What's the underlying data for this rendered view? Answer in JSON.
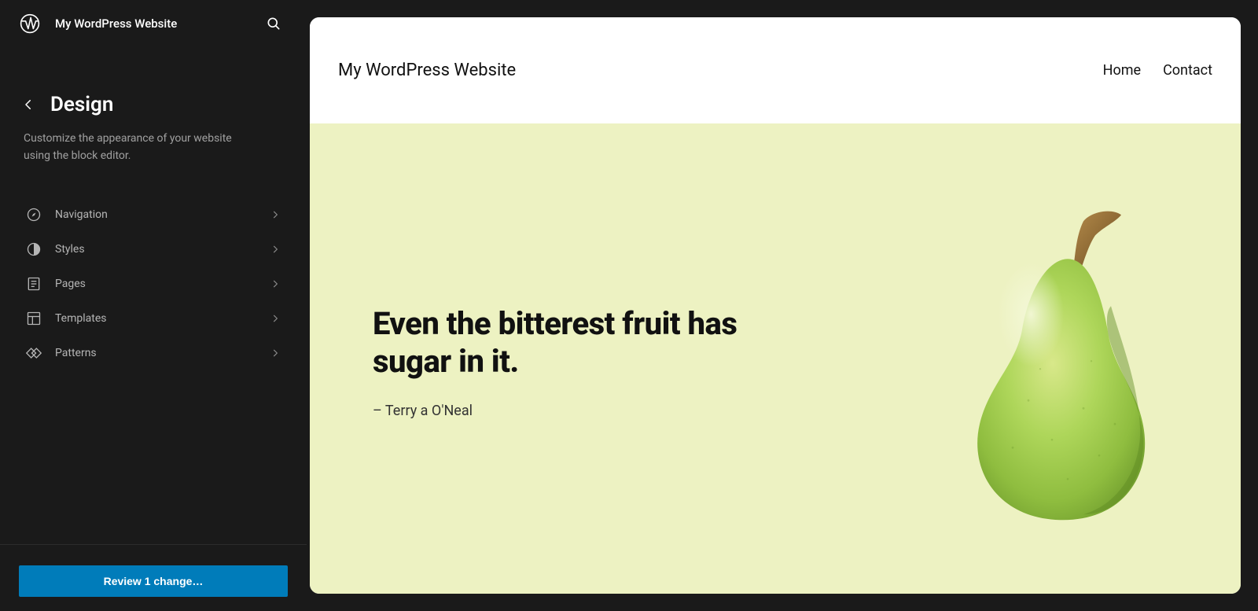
{
  "header": {
    "site_name": "My WordPress Website"
  },
  "panel": {
    "title": "Design",
    "description": "Customize the appearance of your website using the block editor."
  },
  "nav": {
    "items": [
      {
        "label": "Navigation",
        "icon": "compass-icon"
      },
      {
        "label": "Styles",
        "icon": "styles-icon"
      },
      {
        "label": "Pages",
        "icon": "pages-icon"
      },
      {
        "label": "Templates",
        "icon": "templates-icon"
      },
      {
        "label": "Patterns",
        "icon": "patterns-icon"
      }
    ]
  },
  "footer": {
    "review_label": "Review 1 change…"
  },
  "preview": {
    "site_title": "My WordPress Website",
    "nav_items": [
      "Home",
      "Contact"
    ],
    "hero_quote": "Even the bitterest fruit has sugar in it.",
    "hero_attribution": "– Terry a O'Neal",
    "hero_bg_color": "#edf2c2",
    "hero_image_desc": "green pear"
  }
}
